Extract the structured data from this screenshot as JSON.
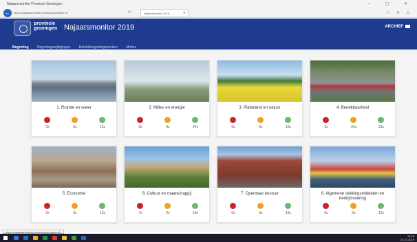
{
  "window": {
    "title": "Najaarsmonitor Provincie Groningen",
    "controls": "–  ▢  ✕"
  },
  "browser": {
    "url": "https://najaarsmonitor.provinciegroningen.nl/",
    "tab_label": "Najaarsmonitor 2019",
    "tab_close": "✕",
    "url_controls": "↻ ·",
    "toolbar_icons": "☆ ≡ ☺",
    "status_url": "https://najaarsmonitor.provinciegroningen.nl/#"
  },
  "header": {
    "logo_line1": "provincie",
    "logo_line2": "groningen",
    "app_title": "Najaarsmonitor 2019",
    "archief_label": "ARCHIEF",
    "nav": [
      {
        "label": "Begroting",
        "active": true
      },
      {
        "label": "Begrotingswijzigingen",
        "active": false
      },
      {
        "label": "Beleidsbegrotingswerken",
        "active": false
      },
      {
        "label": "Moties",
        "active": false
      }
    ]
  },
  "cards": [
    {
      "title": "1. Ruimte en water",
      "red": "0x",
      "orange": "5x",
      "green": "12x",
      "photo": "harbor-water"
    },
    {
      "title": "2. Milieu en energie",
      "red": "2x",
      "orange": "9x",
      "green": "24x",
      "photo": "windmills-power-plant"
    },
    {
      "title": "3. Platteland en natuur",
      "red": "0x",
      "orange": "6x",
      "green": "15x",
      "photo": "rapeseed-field"
    },
    {
      "title": "4. Bereikbaarheid",
      "red": "2x",
      "orange": "31x",
      "green": "31x",
      "photo": "highway-trains"
    },
    {
      "title": "5. Economie",
      "red": "0x",
      "orange": "0x",
      "green": "13x",
      "photo": "city-aerial"
    },
    {
      "title": "6. Cultuur en maatschappij",
      "red": "7x",
      "orange": "2x",
      "green": "10x",
      "photo": "manor-garden"
    },
    {
      "title": "7. Openbaar bestuur",
      "red": "0x",
      "orange": "0x",
      "green": "16x",
      "photo": "provincial-house"
    },
    {
      "title": "8. Algemene dekkingsmiddelen en bedrijfsvoering",
      "red": "0x",
      "orange": "0x",
      "green": "12x",
      "photo": "fishing-boats-harbor"
    }
  ],
  "taskbar": {
    "clock_time": "13:46",
    "clock_date": "22-10-2019"
  },
  "colors": {
    "header": "#1f3b8f",
    "red": "#cf2323",
    "orange": "#f0a023",
    "green": "#6bb870"
  }
}
